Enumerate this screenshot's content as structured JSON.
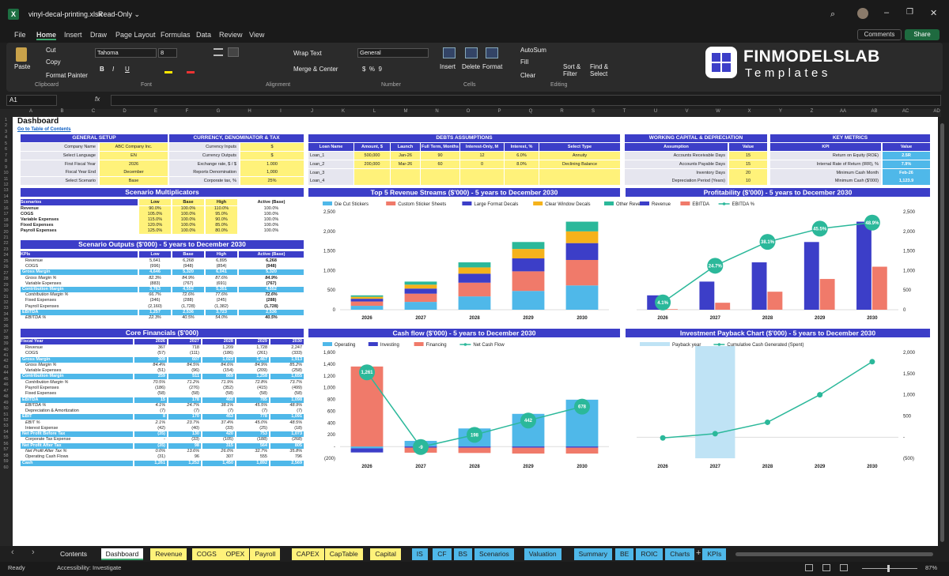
{
  "window": {
    "title": "vinyl-decal-printing.xlsx",
    "mode": "Read-Only ⌄"
  },
  "menu": [
    "File",
    "Home",
    "Insert",
    "Draw",
    "Page Layout",
    "Formulas",
    "Data",
    "Review",
    "View"
  ],
  "menu_right": {
    "comments": "Comments",
    "share": "Share"
  },
  "ribbon": {
    "paste": "Paste",
    "cut": "Cut",
    "copy": "Copy",
    "format_painter": "Format Painter",
    "clipboard": "Clipboard",
    "font_name": "Tahoma",
    "font_size": "8",
    "font_group": "Font",
    "wrap": "Wrap Text",
    "merge": "Merge & Center",
    "alignment": "Alignment",
    "number_format": "General",
    "number": "Number",
    "insert": "Insert",
    "delete": "Delete",
    "format": "Format",
    "cells": "Cells",
    "autosum": "AutoSum",
    "fill": "Fill",
    "clear": "Clear",
    "sort": "Sort & Filter",
    "find": "Find & Select",
    "editing": "Editing"
  },
  "brand": {
    "name": "FINMODELSLAB",
    "sub": "Templates"
  },
  "formula": {
    "namebox": "A1",
    "fx": "fx"
  },
  "columns": [
    "A",
    "B",
    "C",
    "D",
    "E",
    "F",
    "G",
    "H",
    "I",
    "J",
    "K",
    "L",
    "M",
    "N",
    "O",
    "P",
    "Q",
    "R",
    "S",
    "T",
    "U",
    "V",
    "W",
    "X",
    "Y",
    "Z",
    "AA",
    "AB",
    "AC",
    "AD"
  ],
  "sheet": {
    "title": "Dashboard",
    "link": "Go to Table of Contents",
    "general": {
      "title": "GENERAL SETUP",
      "rows": [
        [
          "Company Name",
          "ABC Company Inc."
        ],
        [
          "Select Language",
          "EN"
        ],
        [
          "First Fiscal Year",
          "2026"
        ],
        [
          "Fiscal Year End",
          "December"
        ],
        [
          "Select Scenario",
          "Base"
        ]
      ]
    },
    "currency": {
      "title": "CURRENCY, DENOMINATOR & TAX",
      "rows": [
        [
          "Currency Inputs",
          "$"
        ],
        [
          "Currency Outputs",
          "$"
        ],
        [
          "Exchange rate, $ / $",
          "1.000"
        ],
        [
          "Reports Denomination",
          "1,000"
        ],
        [
          "Corporate tax, %",
          "25%"
        ]
      ]
    },
    "debts": {
      "title": "DEBTS ASSUMPTIONS",
      "headers": [
        "Loan Name",
        "Amount, $",
        "Launch",
        "Full Term, Months",
        "Interest-Only, M",
        "Interest, %",
        "Select Type"
      ],
      "rows": [
        [
          "Loan_1",
          "500,000",
          "Jan-26",
          "90",
          "12",
          "6.0%",
          "Annuity"
        ],
        [
          "Loan_2",
          "200,000",
          "Mar-26",
          "60",
          "0",
          "8.0%",
          "Declining Balance"
        ],
        [
          "Loan_3",
          "",
          "",
          "",
          "",
          "",
          ""
        ],
        [
          "Loan_4",
          "",
          "",
          "",
          "",
          "",
          ""
        ]
      ]
    },
    "wc": {
      "title": "WORKING CAPITAL & DEPRECIATION",
      "headers": [
        "Assumption",
        "Value"
      ],
      "rows": [
        [
          "Accounts Receivable Days",
          "15"
        ],
        [
          "Accounts Payable Days",
          "15"
        ],
        [
          "Inventory Days",
          "20"
        ],
        [
          "Depreciation Period (Years)",
          "10"
        ]
      ]
    },
    "kpi": {
      "title": "KEY METRICS",
      "headers": [
        "KPI",
        "Value"
      ],
      "rows": [
        [
          "Return on Equity (ROE)",
          "2.5R"
        ],
        [
          "Internal Rate of Return (IRR), %",
          "7.9%"
        ],
        [
          "Minimum Cash Month",
          "Feb-26"
        ],
        [
          "Minimum Cash ($'000)",
          "1,123.9"
        ]
      ]
    },
    "multipliers": {
      "title": "Scenario Multiplicators",
      "headers": [
        "Scenarios",
        "Low",
        "Base",
        "High",
        "Active (Base)"
      ],
      "rows": [
        [
          "Revenue",
          "90.0%",
          "100.0%",
          "110.0%",
          "100.0%"
        ],
        [
          "COGS",
          "105.0%",
          "100.0%",
          "95.0%",
          "100.0%"
        ],
        [
          "Variable Expenses",
          "115.0%",
          "100.0%",
          "90.0%",
          "100.0%"
        ],
        [
          "Fixed Expenses",
          "120.0%",
          "100.0%",
          "85.0%",
          "100.0%"
        ],
        [
          "Payroll Expenses",
          "125.0%",
          "100.0%",
          "80.0%",
          "100.0%"
        ]
      ]
    },
    "outputs": {
      "title": "Scenario Outputs ($'000) - 5 years to December 2030",
      "headers": [
        "KPIs",
        "Low",
        "Base",
        "High",
        "Active (Base)"
      ],
      "rows": [
        [
          "Revenue",
          "5,641",
          "6,268",
          "6,895",
          "6,268",
          ""
        ],
        [
          "COGS",
          "(996)",
          "(948)",
          "(854)",
          "(948)",
          ""
        ],
        [
          "Gross Margin",
          "4,646",
          "5,320",
          "6,041",
          "5,320",
          "b"
        ],
        [
          "Gross Margin %",
          "82.3%",
          "84.9%",
          "87.6%",
          "84.9%",
          "i"
        ],
        [
          "Variable Expenses",
          "(883)",
          "(767)",
          "(691)",
          "(767)",
          ""
        ],
        [
          "Contribution Margin",
          "3,763",
          "4,552",
          "5,351",
          "4,552",
          "b"
        ],
        [
          "Contribution Margin %",
          "66.7%",
          "72.6%",
          "77.6%",
          "72.6%",
          "i"
        ],
        [
          "Fixed Expenses",
          "(346)",
          "(288)",
          "(245)",
          "(288)",
          ""
        ],
        [
          "Payroll Expenses",
          "(2,160)",
          "(1,728)",
          "(1,382)",
          "(1,728)",
          ""
        ],
        [
          "EBITDA",
          "1,257",
          "2,536",
          "3,723",
          "2,536",
          "b"
        ],
        [
          "EBITDA %",
          "22.3%",
          "40.5%",
          "54.0%",
          "40.5%",
          "i"
        ]
      ]
    },
    "core": {
      "title": "Core Financials ($'000)",
      "headers": [
        "Fiscal Year",
        "2026",
        "2027",
        "2028",
        "2029",
        "2030"
      ],
      "rows": [
        [
          "Revenue",
          "367",
          "718",
          "1,209",
          "1,728",
          "2,247",
          ""
        ],
        [
          "COGS",
          "(57)",
          "(111)",
          "(186)",
          "(261)",
          "(333)",
          ""
        ],
        [
          "Gross Margin",
          "309",
          "607",
          "1,023",
          "1,467",
          "1,913",
          "b"
        ],
        [
          "Gross Margin %",
          "84.4%",
          "84.5%",
          "84.6%",
          "84.9%",
          "85.2%",
          "i"
        ],
        [
          "Variable Expenses",
          "(51)",
          "(96)",
          "(154)",
          "(209)",
          "(258)",
          ""
        ],
        [
          "Contribution Margin",
          "259",
          "511",
          "869",
          "1,258",
          "1,655",
          "b"
        ],
        [
          "Contribution Margin %",
          "70.5%",
          "71.2%",
          "71.9%",
          "72.8%",
          "73.7%",
          "i"
        ],
        [
          "Payroll Expenses",
          "(186)",
          "(276)",
          "(352)",
          "(415)",
          "(499)",
          ""
        ],
        [
          "Fixed Expenses",
          "(58)",
          "(58)",
          "(58)",
          "(58)",
          "(58)",
          ""
        ],
        [
          "EBITDA",
          "15",
          "178",
          "460",
          "785",
          "1,098",
          "b"
        ],
        [
          "EBITDA %",
          "4.1%",
          "24.7%",
          "38.1%",
          "45.5%",
          "48.9%",
          "i"
        ],
        [
          "Depreciation & Amortization",
          "(7)",
          "(7)",
          "(7)",
          "(7)",
          "(7)",
          ""
        ],
        [
          "EBIT",
          "8",
          "170",
          "453",
          "778",
          "1,091",
          "b"
        ],
        [
          "EBIT %",
          "2.1%",
          "23.7%",
          "37.4%",
          "45.0%",
          "48.5%",
          "i"
        ],
        [
          "Interest Expense",
          "(42)",
          "(40)",
          "(33)",
          "(25)",
          "(18)",
          ""
        ],
        [
          "Net Profit Before Tax",
          "(35)",
          "130",
          "420",
          "753",
          "1,073",
          "b"
        ],
        [
          "Corporate Tax Expense",
          "-",
          "(33)",
          "(105)",
          "(188)",
          "(268)",
          ""
        ],
        [
          "Net Profit After Tax",
          "(35)",
          "98",
          "315",
          "564",
          "805",
          "b"
        ],
        [
          "Net Profit After Tax %",
          "0.0%",
          "13.6%",
          "26.0%",
          "32.7%",
          "35.8%",
          "i"
        ],
        [
          "Operating Cash Flows",
          "(31)",
          "96",
          "307",
          "555",
          "796",
          ""
        ],
        [
          "Cash",
          "1,261",
          "1,252",
          "1,450",
          "1,892",
          "2,569",
          "b"
        ]
      ]
    }
  },
  "tabs": {
    "nav_prev": "‹",
    "nav_next": "›",
    "items": [
      {
        "label": "Contents",
        "style": "plain"
      },
      {
        "label": "Dashboard",
        "style": "active"
      },
      {
        "label": "Revenue",
        "style": "yellow"
      },
      {
        "label": "COGS",
        "style": "yellow"
      },
      {
        "label": "OPEX",
        "style": "yellow"
      },
      {
        "label": "Payroll",
        "style": "yellow"
      },
      {
        "label": "CAPEX",
        "style": "yellow"
      },
      {
        "label": "CapTable",
        "style": "yellow"
      },
      {
        "label": "Capital",
        "style": "yellow"
      },
      {
        "label": "IS",
        "style": "blue"
      },
      {
        "label": "CF",
        "style": "blue"
      },
      {
        "label": "BS",
        "style": "blue"
      },
      {
        "label": "Scenarios",
        "style": "blue"
      },
      {
        "label": "Valuation",
        "style": "blue"
      },
      {
        "label": "Summary",
        "style": "blue"
      },
      {
        "label": "BE",
        "style": "blue"
      },
      {
        "label": "ROIC",
        "style": "blue"
      },
      {
        "label": "Charts",
        "style": "blue"
      },
      {
        "label": "KPIs",
        "style": "blue"
      }
    ],
    "add": "+"
  },
  "status": {
    "ready": "Ready",
    "accessibility": "Accessibility: Investigate",
    "zoom": "87%"
  },
  "colors": {
    "accent": "#3c3ec8",
    "cyan": "#4fb8e9",
    "yellow": "#fff27a",
    "salmon": "#f07a6a",
    "orange": "#f5b21b",
    "teal": "#2bb89a",
    "purple": "#5c47d2",
    "light_blue": "#bfe3f5"
  },
  "chart_data": [
    {
      "id": "revenue",
      "type": "bar",
      "stacked": true,
      "title": "Top 5 Revenue Streams ($'000) - 5 years to December 2030",
      "categories": [
        "2026",
        "2027",
        "2028",
        "2029",
        "2030"
      ],
      "series": [
        {
          "name": "Die Cut Stickers",
          "color": "#4fb8e9",
          "values": [
            100,
            200,
            340,
            480,
            620
          ]
        },
        {
          "name": "Custom Sticker Sheets",
          "color": "#f07a6a",
          "values": [
            110,
            210,
            350,
            500,
            650
          ]
        },
        {
          "name": "Large Format Decals",
          "color": "#3c3ec8",
          "values": [
            70,
            130,
            230,
            330,
            430
          ]
        },
        {
          "name": "Clear Window Decals",
          "color": "#f5b21b",
          "values": [
            50,
            100,
            160,
            240,
            300
          ]
        },
        {
          "name": "Other Revenue",
          "color": "#2bb89a",
          "values": [
            37,
            78,
            129,
            178,
            247
          ]
        }
      ],
      "ylim": [
        0,
        2500
      ],
      "yticks": [
        0,
        500,
        1000,
        1500,
        2000,
        2500
      ]
    },
    {
      "id": "profitability",
      "type": "bar",
      "title": "Profitability ($'000) - 5 years to December 2030",
      "categories": [
        "2026",
        "2027",
        "2028",
        "2029",
        "2030"
      ],
      "series": [
        {
          "name": "Revenue",
          "color": "#3c3ec8",
          "values": [
            367,
            718,
            1209,
            1728,
            2247
          ]
        },
        {
          "name": "EBITDA",
          "color": "#f07a6a",
          "values": [
            15,
            178,
            460,
            785,
            1098
          ]
        },
        {
          "name": "EBITDA %",
          "type": "line",
          "color": "#2bb89a",
          "values": [
            4.1,
            24.7,
            38.1,
            45.5,
            48.9
          ],
          "labels": [
            "4.1%",
            "24.7%",
            "38.1%",
            "45.5%",
            "48.9%"
          ]
        }
      ],
      "ylim": [
        0,
        2500
      ],
      "yticks": [
        0,
        500,
        1000,
        1500,
        2000,
        2500
      ]
    },
    {
      "id": "cashflow",
      "type": "bar",
      "stacked": true,
      "title": "Cash flow ($'000) - 5 years to December 2030",
      "categories": [
        "2026",
        "2027",
        "2028",
        "2029",
        "2030"
      ],
      "series": [
        {
          "name": "Operating",
          "color": "#4fb8e9",
          "values": [
            -31,
            96,
            307,
            555,
            796
          ]
        },
        {
          "name": "Investing",
          "color": "#3c3ec8",
          "values": [
            -70,
            -20,
            -20,
            -20,
            -20
          ]
        },
        {
          "name": "Financing",
          "color": "#f07a6a",
          "values": [
            1360,
            -85,
            -90,
            -100,
            -100
          ]
        },
        {
          "name": "Net Cash Flow",
          "type": "line",
          "color": "#2bb89a",
          "values": [
            1261,
            -9,
            198,
            442,
            678
          ],
          "labels": [
            "1,261",
            "-9",
            "198",
            "442",
            "678"
          ]
        }
      ],
      "ylim": [
        -200,
        1600
      ],
      "yticks": [
        -200,
        0,
        200,
        400,
        600,
        800,
        1000,
        1200,
        1400,
        1600
      ],
      "ytick_labels": [
        "(200)",
        "-",
        "200",
        "400",
        "600",
        "800",
        "1,000",
        "1,200",
        "1,400",
        "1,600"
      ]
    },
    {
      "id": "payback",
      "type": "bar",
      "title": "Investment Payback Chart ($'000) - 5 years to December 2030",
      "categories": [
        "2026",
        "2027",
        "2028",
        "2029",
        "2030"
      ],
      "series": [
        {
          "name": "Payback year",
          "color": "#bfe3f5",
          "values": [
            0,
            1,
            0,
            0,
            0
          ]
        },
        {
          "name": "Cumulative Cash Generated (Spent)",
          "type": "line",
          "color": "#2bb89a",
          "values": [
            -20,
            80,
            350,
            1000,
            1780
          ]
        }
      ],
      "ylim": [
        -500,
        2000
      ],
      "yticks": [
        -500,
        0,
        500,
        1000,
        1500,
        2000
      ],
      "ytick_labels": [
        "(500)",
        "-",
        "500",
        "1,000",
        "1,500",
        "2,000"
      ]
    }
  ]
}
